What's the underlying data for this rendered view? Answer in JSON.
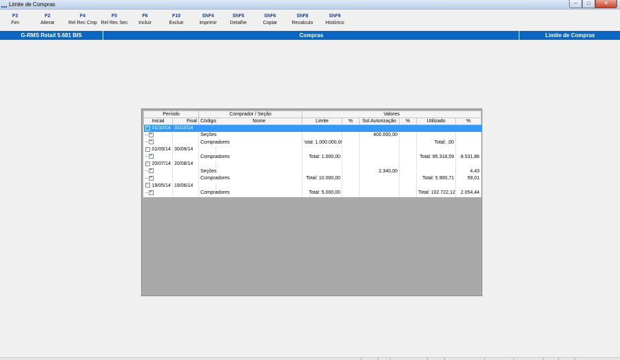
{
  "window": {
    "title": "Limite de Compras"
  },
  "toolbar": [
    {
      "key": "F3",
      "label": "Fim"
    },
    {
      "key": "F2",
      "label": "Alterar"
    },
    {
      "key": "F4",
      "label": "Rel Rec Cmp"
    },
    {
      "key": "F5",
      "label": "Rel Rec Sec"
    },
    {
      "key": "F6",
      "label": "Incluir"
    },
    {
      "key": "F10",
      "label": "Excluir"
    },
    {
      "key": "ShF4",
      "label": "Imprimir"
    },
    {
      "key": "ShF5",
      "label": "Detalhe"
    },
    {
      "key": "ShF6",
      "label": "Copiar"
    },
    {
      "key": "ShF8",
      "label": "Recalculo"
    },
    {
      "key": "ShF9",
      "label": "Histórico"
    }
  ],
  "status": {
    "left": "G-RMS Retail 5.681 BIS",
    "center": "Compras",
    "right": "Limite de Compras"
  },
  "grid": {
    "groups": {
      "periodo": "Período",
      "comprador": "Comprador / Seção",
      "valores": "Valores"
    },
    "columns": [
      "Inicial",
      "Final",
      "Código",
      "Nome",
      "Limite",
      "%",
      "Sol.Autorização",
      "%",
      "Utilizado",
      "%"
    ],
    "rows": [
      {
        "type": "period",
        "selected": true,
        "inicial": "01/10/14",
        "final": "31/10/14"
      },
      {
        "type": "child",
        "nome": "Seções",
        "limite": "",
        "pct1": "",
        "sol": "400.000,00",
        "pct2": "",
        "utilizado": "",
        "pct3": ""
      },
      {
        "type": "child",
        "nome": "Compradores",
        "limite": "'otal: 1.000.000,00",
        "pct1": "",
        "sol": "",
        "pct2": "",
        "utilizado": "Total: ,00",
        "pct3": ""
      },
      {
        "type": "period",
        "selected": false,
        "inicial": "01/09/14",
        "final": "30/09/14"
      },
      {
        "type": "child",
        "nome": "Compradores",
        "limite": "Total: 1.000,00",
        "pct1": "",
        "sol": "",
        "pct2": "",
        "utilizado": "Total: 85.318,59",
        "pct3": "8.531,86"
      },
      {
        "type": "period",
        "selected": false,
        "inicial": "20/07/14",
        "final": "20/08/14"
      },
      {
        "type": "child",
        "nome": "Seções",
        "limite": "",
        "pct1": "",
        "sol": "2.340,00",
        "pct2": "",
        "utilizado": "",
        "pct3": "4,43"
      },
      {
        "type": "child",
        "nome": "Compradores",
        "limite": "Total: 10.000,00",
        "pct1": "",
        "sol": "",
        "pct2": "",
        "utilizado": "Total: 5.900,71",
        "pct3": "59,01"
      },
      {
        "type": "period",
        "selected": false,
        "inicial": "19/05/14",
        "final": "19/06/14"
      },
      {
        "type": "child",
        "nome": "Compradores",
        "limite": "Total: 5.000,00",
        "pct1": "",
        "sol": "",
        "pct2": "",
        "utilizado": "Total: 102.722,12",
        "pct3": "2.054,44"
      }
    ]
  },
  "colors": {
    "accent": "#0a66c2",
    "selection": "#3399ff",
    "grid_background": "#a9a9a9"
  },
  "icons": {
    "expanded": "minus-box-icon",
    "collapsed": "plus-box-icon"
  }
}
